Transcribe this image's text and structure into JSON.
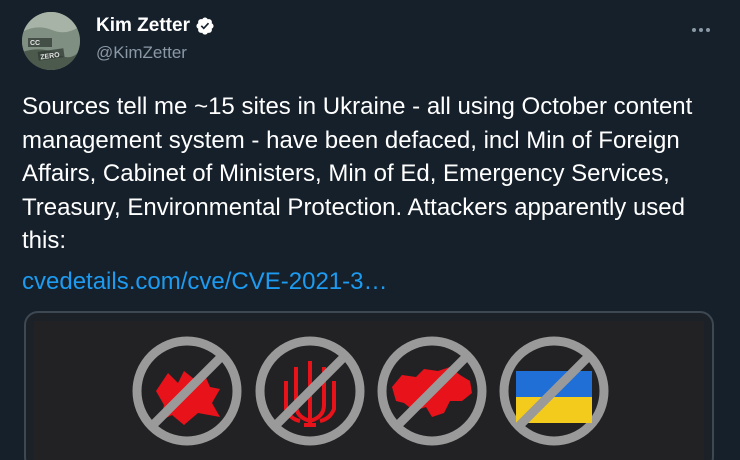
{
  "author": {
    "display_name": "Kim Zetter",
    "handle": "@KimZetter",
    "verified": true,
    "avatar_text": [
      "CC",
      "ZERO"
    ]
  },
  "tweet": {
    "text": "Sources tell me ~15 sites in Ukraine - all using October content management system - have been defaced, incl Min of Foreign Affairs, Cabinet of Ministers, Min of Ed, Emergency Services, Treasury, Environmental Protection. Attackers apparently used this:",
    "link_text": "cvedetails.com/cve/CVE-2021-3…"
  },
  "media": {
    "icons": [
      "crossed-out-red-symbol",
      "crossed-out-trident",
      "crossed-out-ukraine-map",
      "crossed-out-ukraine-flag"
    ]
  },
  "colors": {
    "background": "#15202b",
    "text": "#ffffff",
    "secondary_text": "#8b98a5",
    "link": "#1d9bf0",
    "verified_badge": "#ffffff",
    "prohibition_circle": "#9a9a9a",
    "symbol_red": "#e8121a",
    "flag_blue": "#1f6fd6",
    "flag_yellow": "#f3cb1c"
  }
}
